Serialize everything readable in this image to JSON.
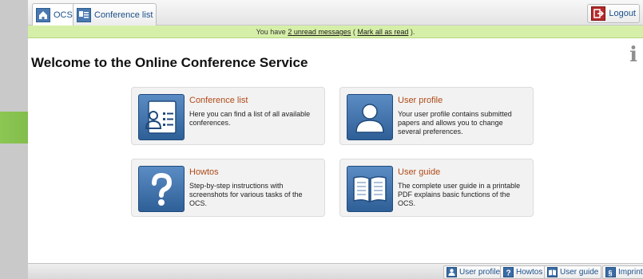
{
  "tabs": [
    {
      "label": "OCS",
      "icon": "home-icon"
    },
    {
      "label": "Conference list",
      "icon": "conference-list-icon"
    }
  ],
  "logout_label": "Logout",
  "message": {
    "prefix": "You have ",
    "unread_link": "2 unread messages",
    "middle": " ( ",
    "mark_link": "Mark all as read",
    "suffix": " )."
  },
  "page_title": "Welcome to the Online Conference Service",
  "cards": [
    {
      "title": "Conference list",
      "description": "Here you can find a list of all available conferences.",
      "icon": "conference-list-icon"
    },
    {
      "title": "User profile",
      "description": "Your user profile contains submitted papers and allows you to change several preferences.",
      "icon": "user-profile-icon"
    },
    {
      "title": "Howtos",
      "description": "Step-by-step instructions with screenshots for various tasks of the OCS.",
      "icon": "question-icon"
    },
    {
      "title": "User guide",
      "description": "The complete user guide in a printable PDF explains basic functions of the OCS.",
      "icon": "book-icon"
    }
  ],
  "footer": [
    {
      "label": "User profile",
      "icon": "user-icon"
    },
    {
      "label": "Howtos",
      "icon": "question-icon"
    },
    {
      "label": "User guide",
      "icon": "book-icon"
    },
    {
      "label": "Imprint",
      "icon": "imprint-icon"
    }
  ],
  "colors": {
    "accent": "#b04a17",
    "message_bg": "#d6efa8",
    "arrow": "#6aa83c",
    "icon_blue": "#3b6ca6"
  }
}
